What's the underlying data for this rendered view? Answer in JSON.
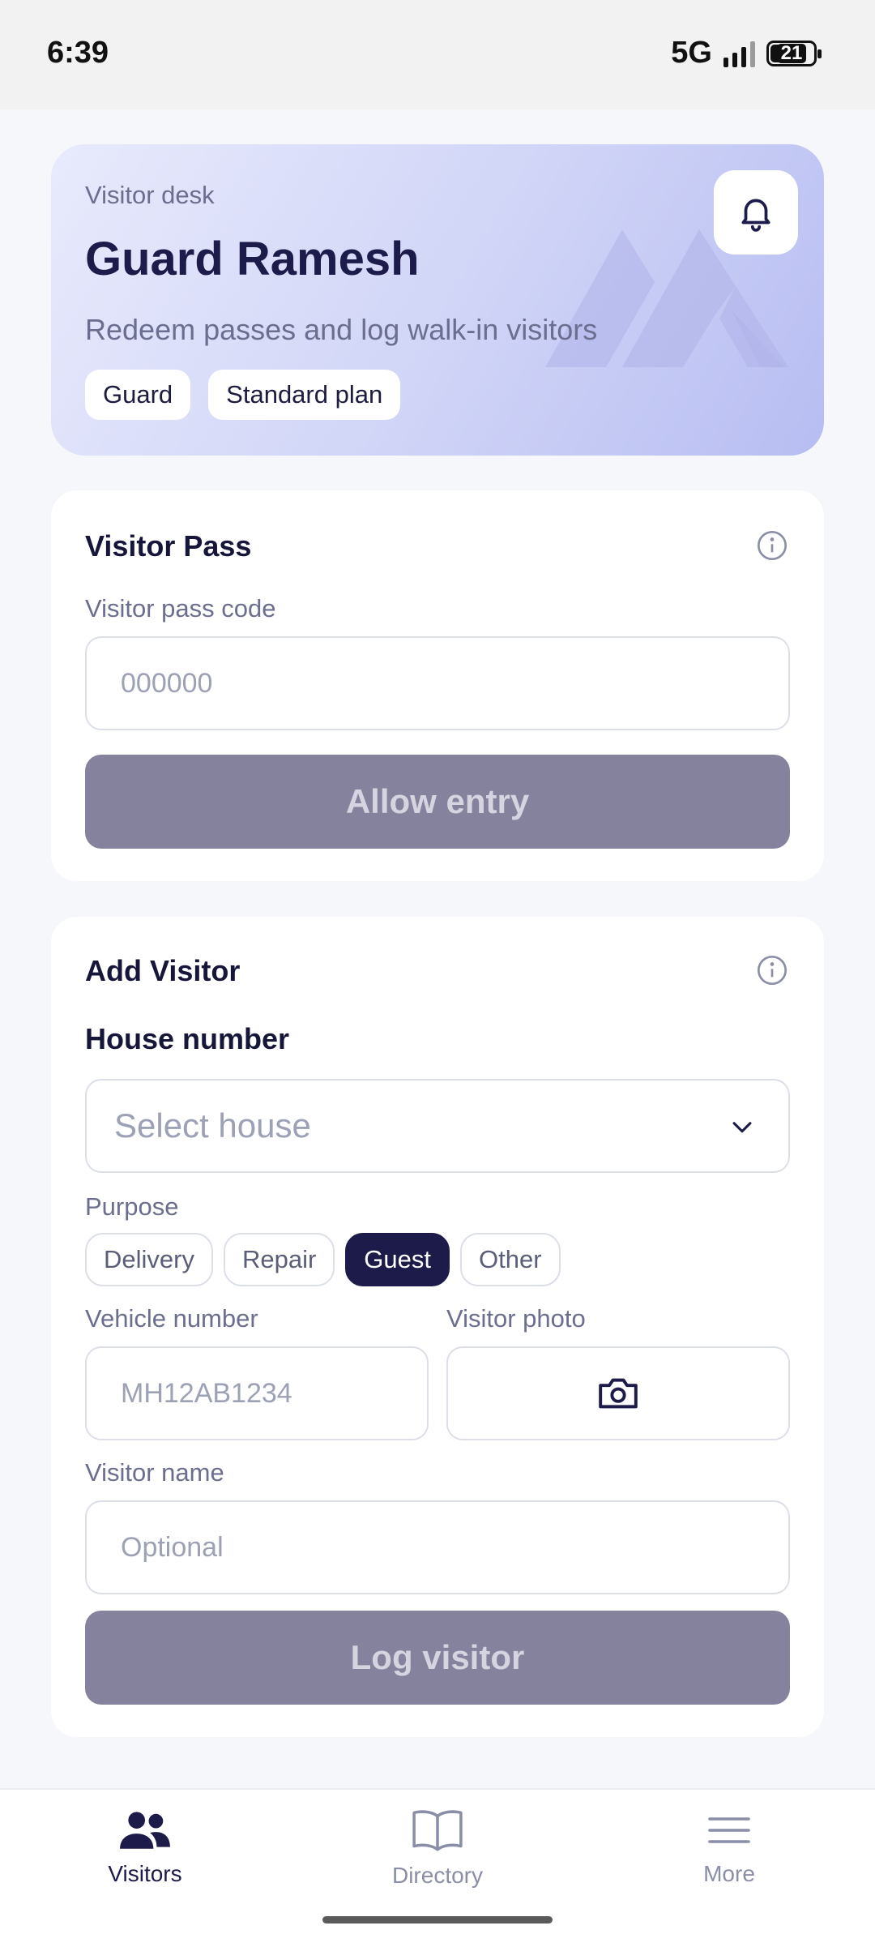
{
  "status_bar": {
    "time": "6:39",
    "network": "5G",
    "battery": "21"
  },
  "hero": {
    "subtitle": "Visitor desk",
    "name": "Guard Ramesh",
    "description": "Redeem passes and log walk-in visitors",
    "chips": [
      "Guard",
      "Standard plan"
    ]
  },
  "visitor_pass": {
    "title": "Visitor Pass",
    "code_label": "Visitor pass code",
    "code_placeholder": "000000",
    "button": "Allow entry"
  },
  "add_visitor": {
    "title": "Add Visitor",
    "house_label": "House number",
    "house_placeholder": "Select house",
    "purpose_label": "Purpose",
    "purposes": [
      "Delivery",
      "Repair",
      "Guest",
      "Other"
    ],
    "selected_purpose": "Guest",
    "vehicle_label": "Vehicle number",
    "vehicle_placeholder": "MH12AB1234",
    "photo_label": "Visitor photo",
    "name_label": "Visitor name",
    "name_placeholder": "Optional",
    "button": "Log visitor"
  },
  "nav": {
    "items": [
      "Visitors",
      "Directory",
      "More"
    ],
    "active": "Visitors"
  },
  "colors": {
    "primary": "#1c1b4a",
    "disabled_button": "#84829c",
    "muted_text": "#6b6e8f"
  }
}
